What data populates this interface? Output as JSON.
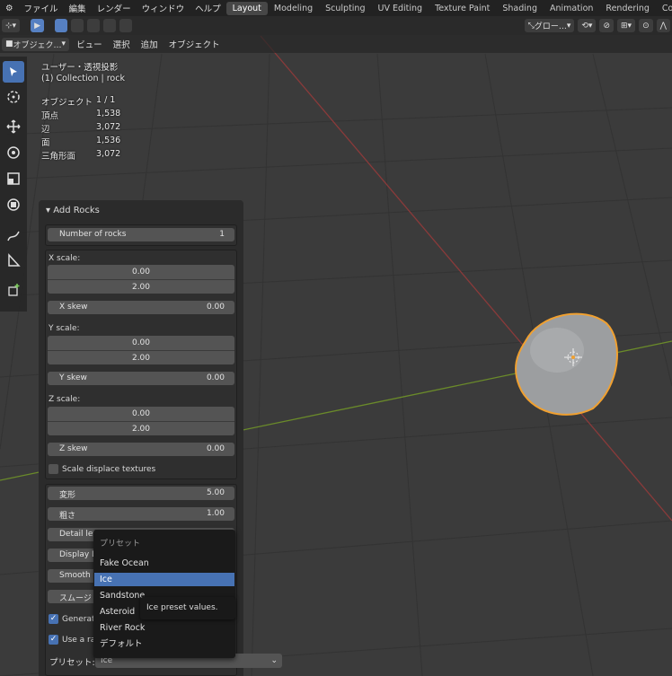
{
  "menubar": {
    "menus": [
      "ファイル",
      "編集",
      "レンダー",
      "ウィンドウ",
      "ヘルプ"
    ],
    "workspaces": [
      "Layout",
      "Modeling",
      "Sculpting",
      "UV Editing",
      "Texture Paint",
      "Shading",
      "Animation",
      "Rendering",
      "Compositin"
    ],
    "active_workspace": "Layout"
  },
  "header": {
    "orientation": "グロー…",
    "mode": "オブジェク…",
    "menus": [
      "ビュー",
      "選択",
      "追加",
      "オブジェクト"
    ]
  },
  "overlay": {
    "view_name": "ユーザー・透視投影",
    "collection": "(1) Collection | rock",
    "stats": [
      {
        "label": "オブジェクト",
        "value": "1 / 1"
      },
      {
        "label": "頂点",
        "value": "1,538"
      },
      {
        "label": "辺",
        "value": "3,072"
      },
      {
        "label": "面",
        "value": "1,536"
      },
      {
        "label": "三角形面",
        "value": "3,072"
      }
    ]
  },
  "operator": {
    "title": "Add Rocks",
    "number_of_rocks": {
      "label": "Number of rocks",
      "value": "1"
    },
    "x_scale": {
      "label": "X scale:",
      "min": "0.00",
      "max": "2.00"
    },
    "x_skew": {
      "label": "X skew",
      "value": "0.00"
    },
    "y_scale": {
      "label": "Y scale:",
      "min": "0.00",
      "max": "2.00"
    },
    "y_skew": {
      "label": "Y skew",
      "value": "0.00"
    },
    "z_scale": {
      "label": "Z scale:",
      "min": "0.00",
      "max": "2.00"
    },
    "z_skew": {
      "label": "Z skew",
      "value": "0.00"
    },
    "scale_displace": "Scale displace textures",
    "deform": {
      "label": "変形",
      "value": "5.00"
    },
    "roughness": {
      "label": "粗さ",
      "value": "1.00"
    },
    "detail": "Detail lev",
    "display": "Display D",
    "smooth_factor": "Smooth F",
    "smooth": "スムージ",
    "generate": "Generate",
    "use_random": "Use a ran",
    "preset_label": "プリセット:",
    "preset_value": "Ice"
  },
  "dropdown": {
    "header": "プリセット",
    "items": [
      "Fake Ocean",
      "Ice",
      "Sandstone",
      "Asteroid",
      "River Rock",
      "デフォルト"
    ],
    "highlighted": "Ice"
  },
  "tooltip": "Ice preset values.",
  "colors": {
    "accent": "#4772b3",
    "selection_outline": "#f0a030",
    "x_axis": "#8a3a3a",
    "y_axis": "#6a8a2a"
  }
}
